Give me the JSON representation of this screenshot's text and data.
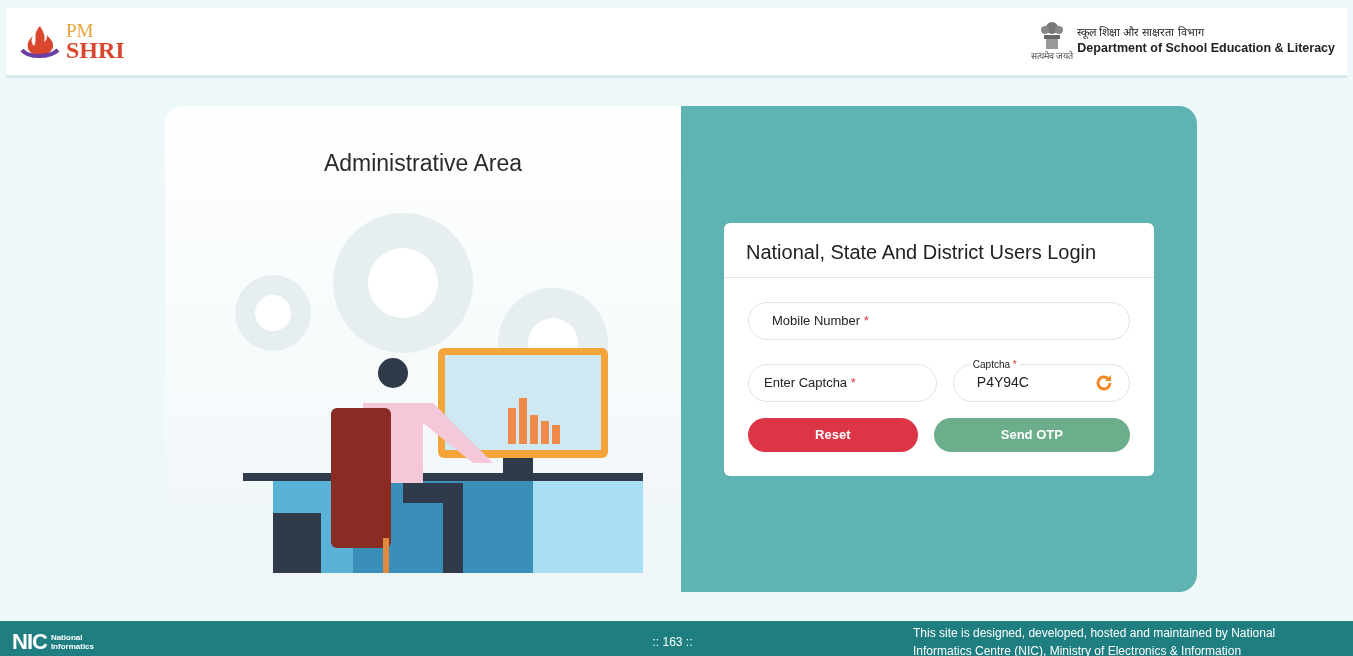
{
  "header": {
    "logo": {
      "line_1": "PM",
      "line_2": "SHRI"
    },
    "emblem_motto": "सत्यमेव जयते",
    "department_hindi": "स्कूल शिक्षा और साक्षरता विभाग",
    "department_english": "Department of School Education & Literacy"
  },
  "left_panel": {
    "title": "Administrative Area"
  },
  "login": {
    "title": "National, State And District Users Login",
    "fields": [
      {
        "kind": "text",
        "label": "Mobile Number",
        "required_mark": "*"
      },
      {
        "kind": "text",
        "label": "Enter Captcha",
        "required_mark": "*"
      },
      {
        "kind": "captcha",
        "label": "Captcha",
        "required_mark": "*",
        "value": "P4Y94C"
      }
    ],
    "buttons": [
      {
        "label": "Reset",
        "kind": "reset"
      },
      {
        "label": "Send OTP",
        "kind": "submit"
      }
    ]
  },
  "footer": {
    "nic_logo": {
      "mark": "NIC",
      "line_1": "National",
      "line_2": "Informatics"
    },
    "visitor_count": ":: 163 ::",
    "credit": "This site is designed, developed, hosted and maintained by National Informatics Centre (NIC), Ministry of Electronics & Information"
  }
}
